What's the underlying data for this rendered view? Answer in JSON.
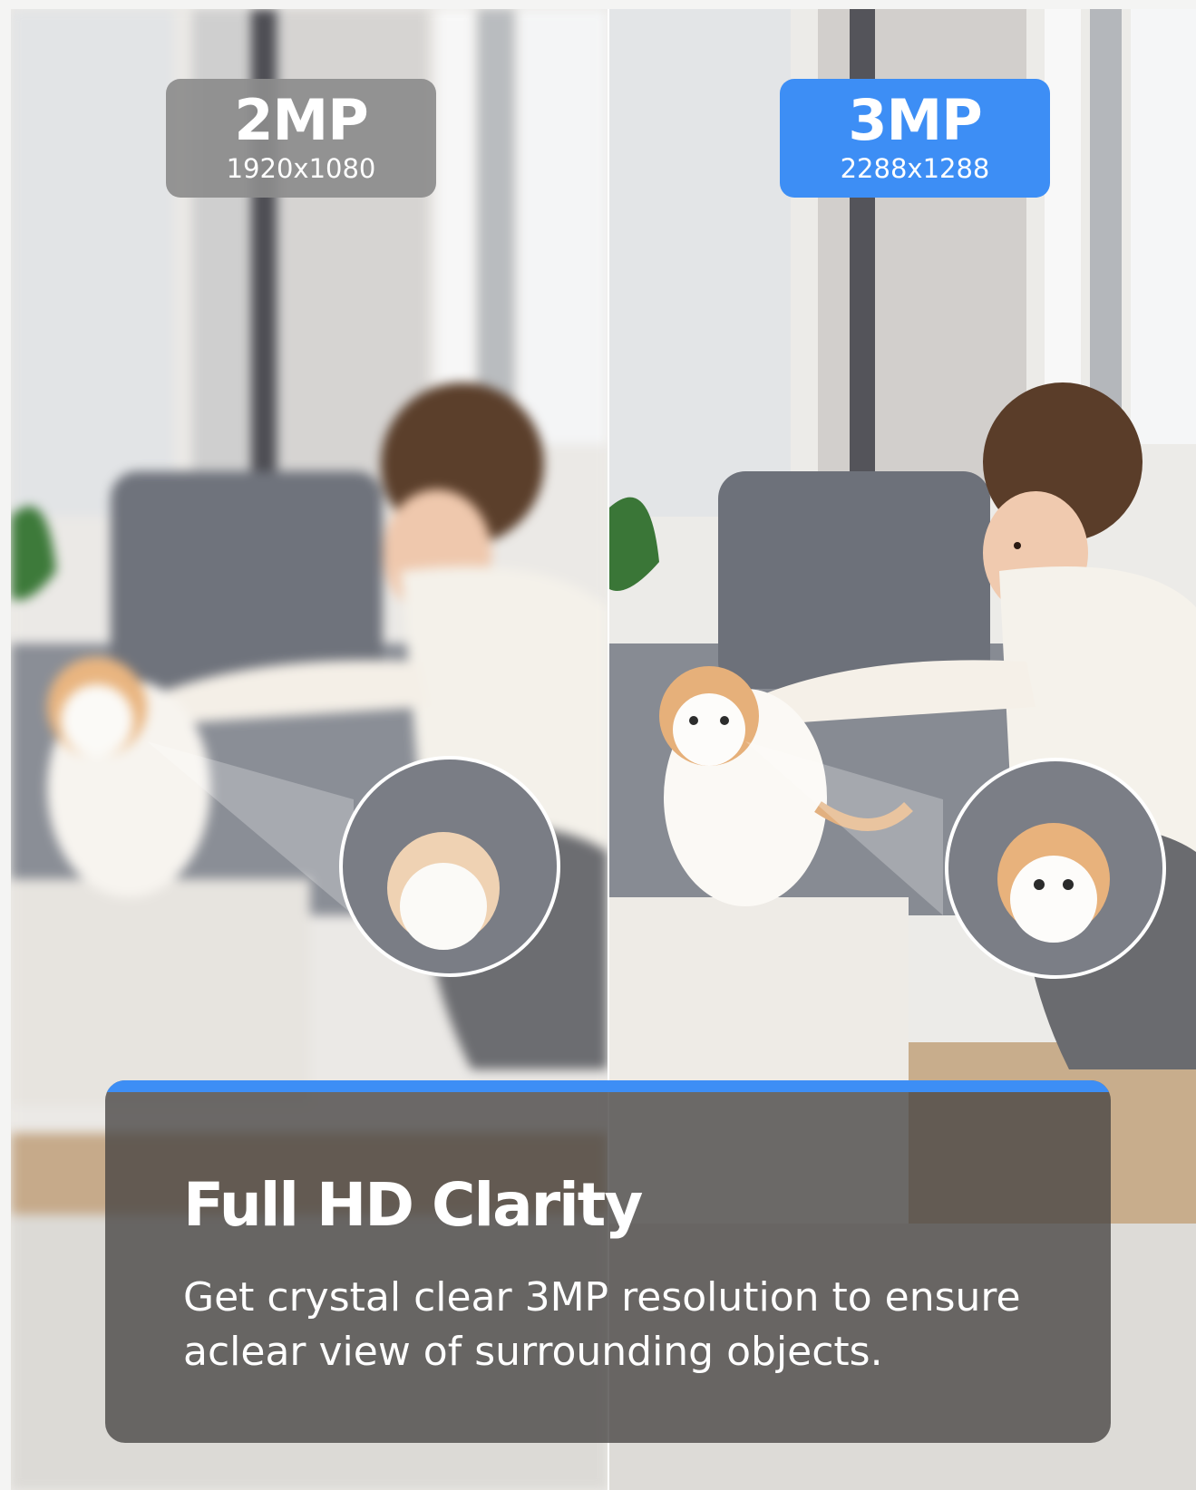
{
  "comparison": {
    "left": {
      "resolution_label": "2MP",
      "dimensions": "1920x1080",
      "badge_color": "#8c8c8c"
    },
    "right": {
      "resolution_label": "3MP",
      "dimensions": "2288x1288",
      "badge_color": "#3d8ef5"
    }
  },
  "caption": {
    "title": "Full HD Clarity",
    "body": "Get crystal clear 3MP resolution to ensure aclear view of surrounding objects.",
    "accent_color": "#3d8ef5"
  },
  "photo": {
    "left_subject": "child-and-kitten-photo-pixelated",
    "right_subject": "child-and-kitten-photo-sharp",
    "zoom_inset": "kitten-zoom-circle"
  }
}
